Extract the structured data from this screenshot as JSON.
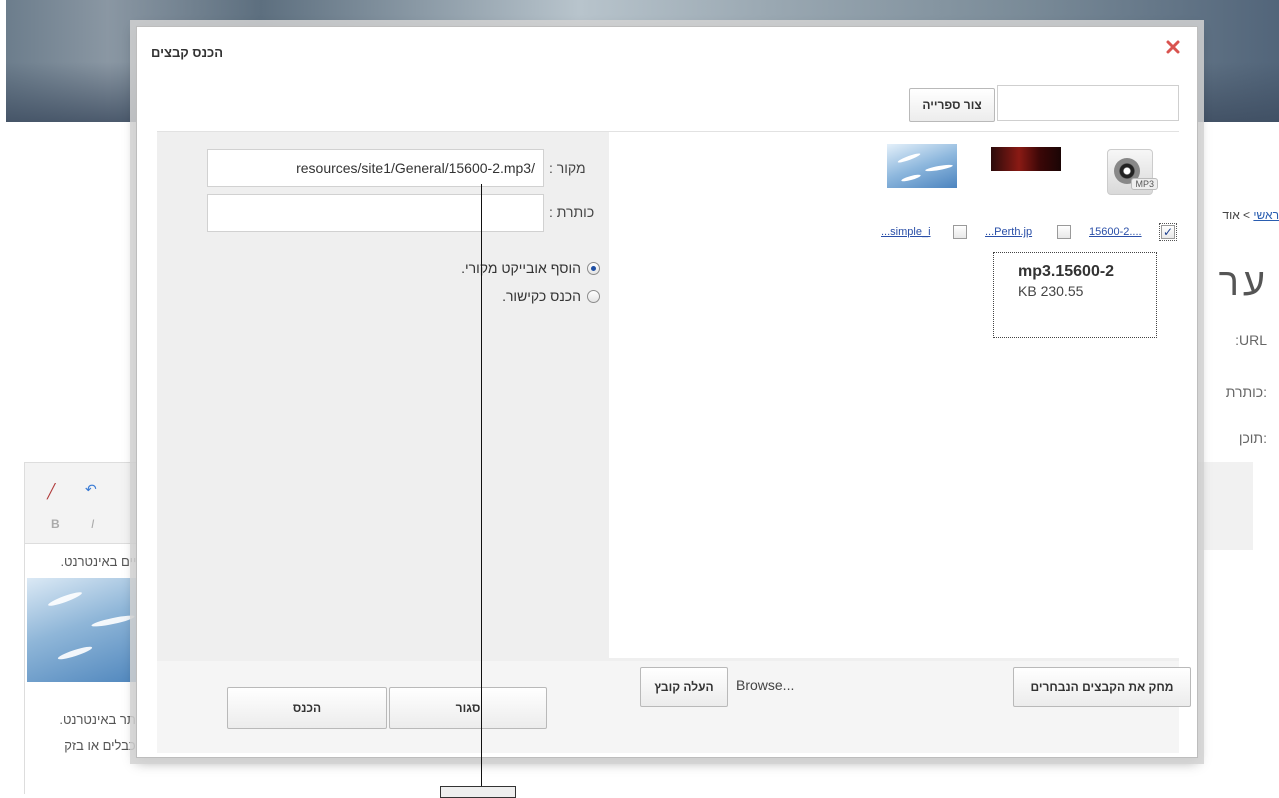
{
  "background": {
    "breadcrumb_home": "ראשי",
    "breadcrumb_rest": " > אוד",
    "page_heading": "ער",
    "label_url": ":URL",
    "label_title": "כותרת:",
    "label_content": "תוכן:",
    "content_line_1": "קיים באינטרנט.",
    "content_line_2": "אתר באינטרנט.",
    "content_line_3": "הכבלים או בזק"
  },
  "dialog": {
    "title": "הכנס קבצים",
    "create_folder_button": "צור ספרייה",
    "folder_name_value": ""
  },
  "properties": {
    "source_label": "מקור :",
    "source_value": "resources/site1/General/15600-2.mp3/",
    "title_label": "כותרת :",
    "title_value": "",
    "radio_add_object": "הוסף אובייקט מקורי.",
    "radio_insert_link": "הכנס כקישור.",
    "selected_radio": "add_object"
  },
  "files": [
    {
      "name": "15600-2....",
      "type": "mp3",
      "icon": "mp3-file-icon",
      "checked": true
    },
    {
      "name": "...Perth.jp",
      "type": "image",
      "icon": "perth-image-thumbnail",
      "checked": false
    },
    {
      "name": "...simple_i",
      "type": "image",
      "icon": "birds-image-thumbnail",
      "checked": false
    }
  ],
  "file_info": {
    "name": "mp3.15600-2",
    "size": "KB 230.55"
  },
  "footer": {
    "delete_selected_button": "מחק את הקבצים הנבחרים",
    "browse_label": "Browse...",
    "upload_button": "העלה קובץ",
    "close_button": "סגור",
    "insert_button": "הכנס"
  },
  "colors": {
    "link": "#2a4fa8",
    "close_icon": "#d9534f",
    "radio_selected": "#1f4fa3"
  }
}
